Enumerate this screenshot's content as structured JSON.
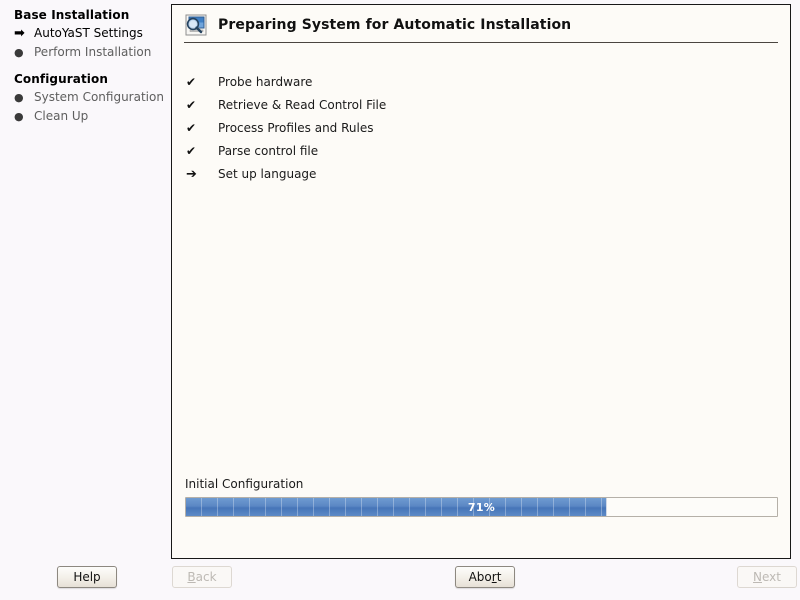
{
  "sidebar": {
    "groups": [
      {
        "title": "Base Installation",
        "items": [
          {
            "label": "AutoYaST Settings",
            "marker": "➡",
            "state": "current"
          },
          {
            "label": "Perform Installation",
            "marker": "●",
            "state": "pending"
          }
        ]
      },
      {
        "title": "Configuration",
        "items": [
          {
            "label": "System Configuration",
            "marker": "●",
            "state": "pending"
          },
          {
            "label": "Clean Up",
            "marker": "●",
            "state": "pending"
          }
        ]
      }
    ]
  },
  "panel": {
    "title": "Preparing System for Automatic Installation",
    "icon": "monitor-magnifier-icon",
    "checklist": [
      {
        "mark": "✔",
        "label": "Probe hardware",
        "state": "done"
      },
      {
        "mark": "✔",
        "label": "Retrieve & Read Control File",
        "state": "done"
      },
      {
        "mark": "✔",
        "label": "Process Profiles and Rules",
        "state": "done"
      },
      {
        "mark": "✔",
        "label": "Parse control file",
        "state": "done"
      },
      {
        "mark": "➔",
        "label": "Set up language",
        "state": "running"
      }
    ],
    "progress": {
      "label": "Initial Configuration",
      "percent_text": "71%",
      "percent_value": 71
    }
  },
  "buttons": {
    "help": {
      "label": "Help",
      "mnemonic": "",
      "enabled": true
    },
    "back": {
      "label": "Back",
      "mnemonic": "B",
      "enabled": false
    },
    "abort": {
      "label": "Abort",
      "mnemonic": "r",
      "enabled": true
    },
    "next": {
      "label": "Next",
      "mnemonic": "N",
      "enabled": false
    }
  },
  "colors": {
    "accent": "#4675b8",
    "panel_bg": "#fdfbf7",
    "page_bg": "#faf8fb",
    "border": "#181818"
  }
}
